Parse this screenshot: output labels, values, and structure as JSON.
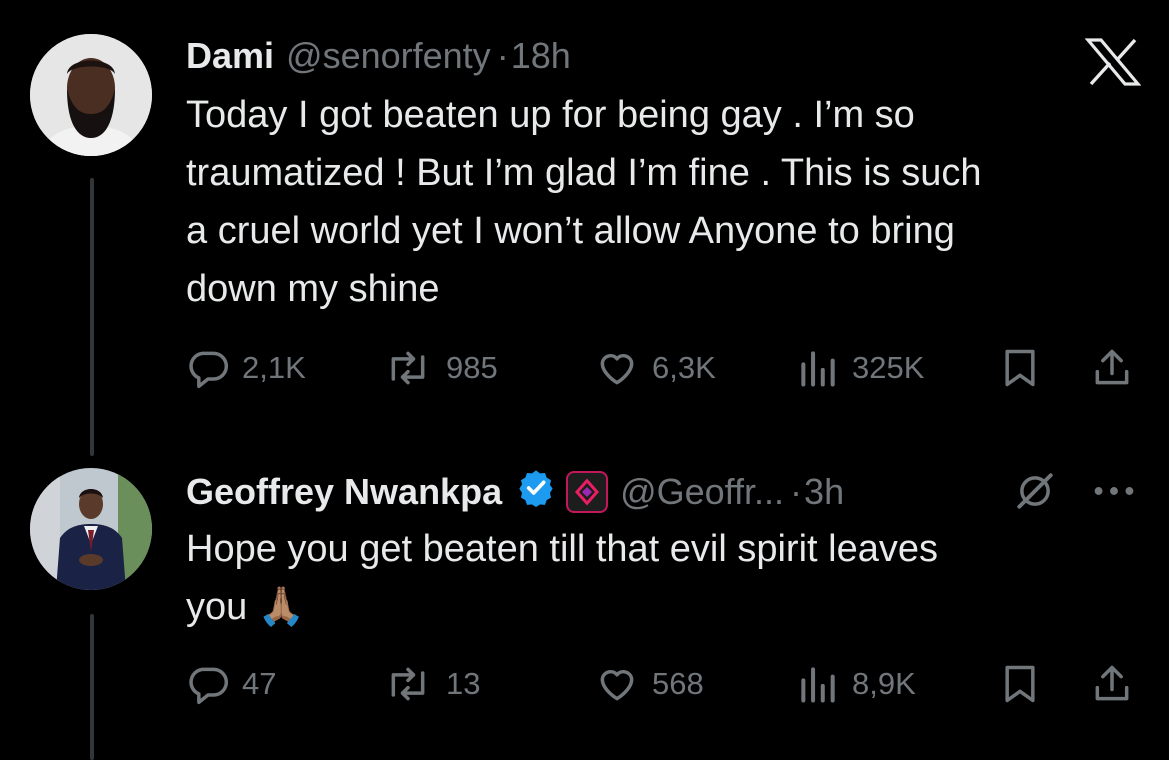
{
  "brand": {
    "logo_icon": "x-logo-icon"
  },
  "tweets": [
    {
      "name": "Dami",
      "handle": "@senorfenty",
      "separator": "·",
      "time": "18h",
      "text": "Today I got beaten up for being gay . I’m so\ntraumatized ! But I’m glad I’m fine . This is such\na cruel world yet I won’t allow Anyone to bring\ndown my shine",
      "stats": {
        "replies": "2,1K",
        "reposts": "985",
        "likes": "6,3K",
        "views": "325K"
      }
    },
    {
      "name": "Geoffrey Nwankpa",
      "handle": "@Geoffr...",
      "separator": "·",
      "time": "3h",
      "text": "Hope you get beaten till that evil spirit leaves\nyou 🙏🏽",
      "stats": {
        "replies": "47",
        "reposts": "13",
        "likes": "568",
        "views": "8,9K"
      }
    }
  ],
  "colors": {
    "background": "#000000",
    "text": "#e7e9ea",
    "muted": "#71767b",
    "verified": "#1d9bf0",
    "affiliate": "#c2185b"
  }
}
